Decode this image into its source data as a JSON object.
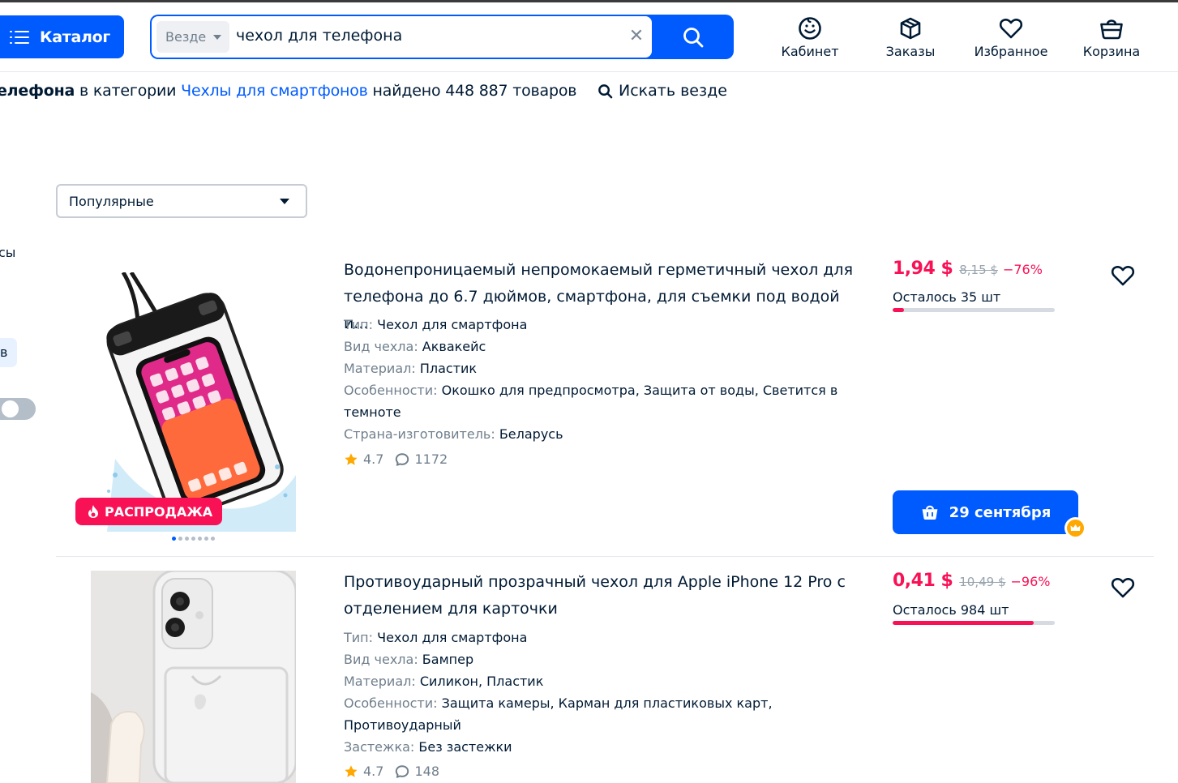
{
  "header": {
    "catalog_label": "Каталог",
    "search_scope": "Везде",
    "search_query": "чехол для телефона",
    "nav": [
      {
        "label": "Кабинет",
        "icon": "face-icon"
      },
      {
        "label": "Заказы",
        "icon": "box-icon"
      },
      {
        "label": "Избранное",
        "icon": "heart-icon"
      },
      {
        "label": "Корзина",
        "icon": "basket-icon"
      }
    ]
  },
  "results": {
    "query_part": "елефона",
    "in_category": " в категории ",
    "category": "Чехлы для смартфонов",
    "found_text": " найдено 448 887 товаров",
    "search_all": "Искать везде"
  },
  "sort": {
    "selected": "Популярные"
  },
  "sidebar": {
    "label_fragment": "сы",
    "chip_fragment": "в"
  },
  "products": [
    {
      "title": "Водонепроницаемый непромокаемый герметичный чехол для телефона до 6.7 дюймов, смартфона, для съемки под водой и...",
      "attrs": [
        {
          "k": "Тип: ",
          "v": "Чехол для смартфона"
        },
        {
          "k": "Вид чехла: ",
          "v": "Аквакейс"
        },
        {
          "k": "Материал: ",
          "v": "Пластик"
        },
        {
          "k": "Особенности: ",
          "v": "Окошко для предпросмотра, Защита от воды, Светится в темноте"
        },
        {
          "k": "Страна-изготовитель: ",
          "v": "Беларусь"
        }
      ],
      "rating": "4.7",
      "reviews": "1172",
      "price": "1,94 $",
      "old_price": "8,15 $",
      "discount": "−76%",
      "stock": "Осталось 35 шт",
      "stock_fraction": 0.07,
      "badge": "РАСПРОДАЖА",
      "delivery": "29 сентября"
    },
    {
      "title": "Противоударный прозрачный чехол для Apple iPhone 12 Pro с отделением для карточки",
      "attrs": [
        {
          "k": "Тип: ",
          "v": "Чехол для смартфона"
        },
        {
          "k": "Вид чехла: ",
          "v": "Бампер"
        },
        {
          "k": "Материал: ",
          "v": "Силикон, Пластик"
        },
        {
          "k": "Особенности: ",
          "v": "Защита камеры, Карман для пластиковых карт, Противоударный"
        },
        {
          "k": "Застежка: ",
          "v": "Без застежки"
        }
      ],
      "rating": "4.7",
      "reviews": "148",
      "price": "0,41 $",
      "old_price": "10,49 $",
      "discount": "−96%",
      "stock": "Осталось 984 шт",
      "stock_fraction": 0.87
    }
  ],
  "colors": {
    "brand": "#005bff",
    "price": "#f91155",
    "muted": "#707f8d",
    "star": "#ffa800"
  }
}
